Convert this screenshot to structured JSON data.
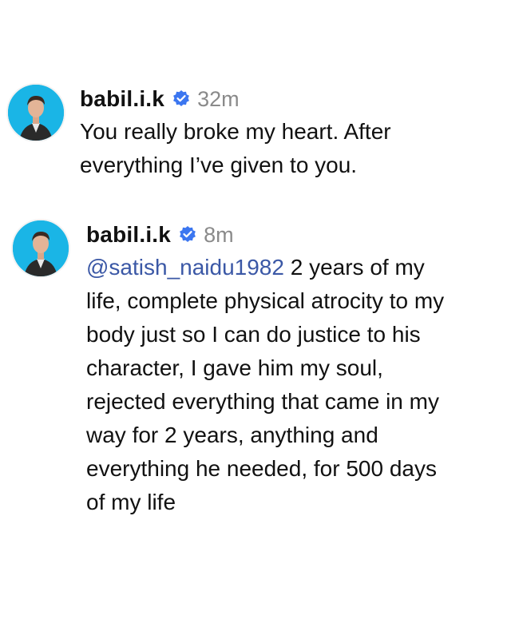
{
  "posts": [
    {
      "username": "babil.i.k",
      "time": "32m",
      "text": "You really broke my heart. After everything I’ve given to you."
    },
    {
      "username": "babil.i.k",
      "time": "8m",
      "mention": "@satish_naidu1982",
      "text": " 2 years of my life, complete physical atrocity to my body just so I can do justice to his character, I gave him my soul, rejected everything that came in my way for 2 years, anything and everything he needed, for 500 days of my life"
    }
  ],
  "icons": {
    "verified": "verified-badge-icon",
    "avatar": "profile-avatar"
  },
  "colors": {
    "avatar_bg": "#1ab5e6",
    "verified": "#3b76f0",
    "mention": "#3b58a6",
    "timestamp": "#8a8a8a"
  }
}
